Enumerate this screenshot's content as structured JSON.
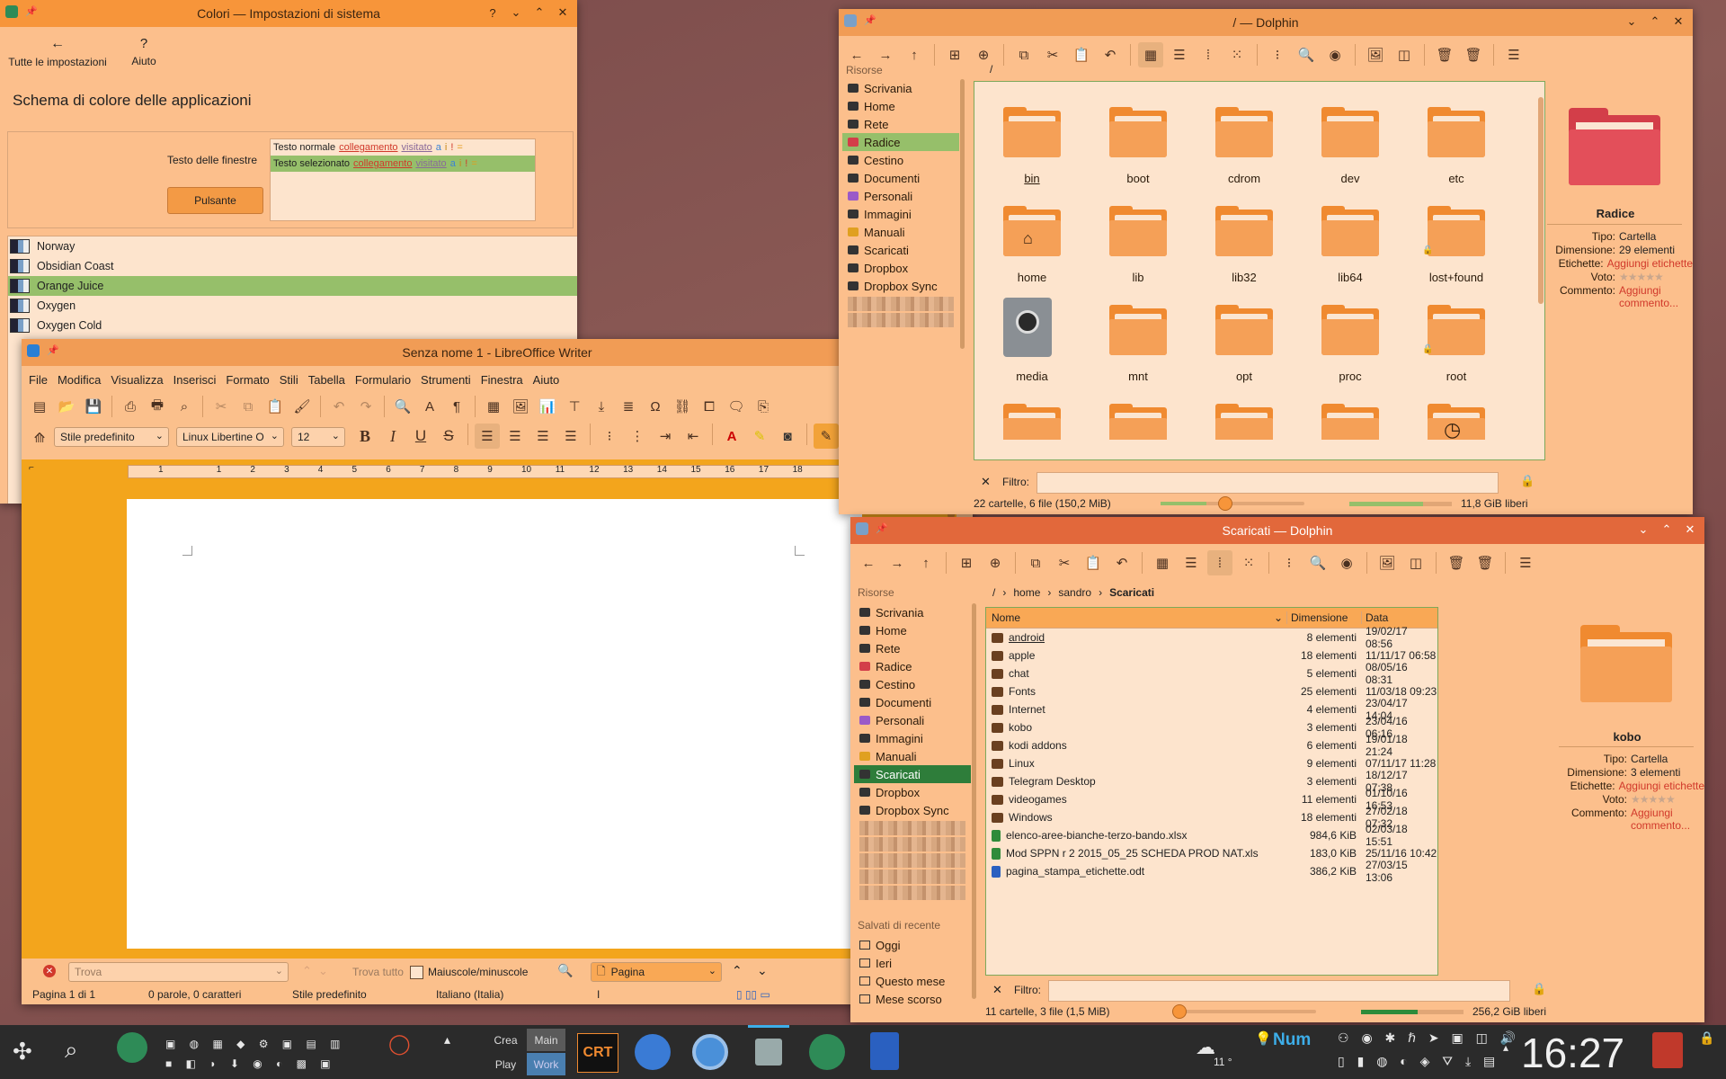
{
  "colors_window": {
    "title": "Colori — Impostazioni di sistema",
    "nav_all": "Tutte le impostazioni",
    "nav_help": "Aiuto",
    "heading": "Schema di colore delle applicazioni",
    "preview_window_text_label": "Testo delle finestre",
    "preview_button_label": "Pulsante",
    "preview_normal": "Testo normale",
    "preview_selected": "Testo selezionato",
    "preview_link": "collegamento",
    "preview_visited": "visitato",
    "preview_glyphs": [
      "a",
      "i",
      "!",
      "="
    ],
    "schemes": [
      {
        "name": "Norway"
      },
      {
        "name": "Obsidian Coast"
      },
      {
        "name": "Orange Juice"
      },
      {
        "name": "Oxygen"
      },
      {
        "name": "Oxygen Cold"
      }
    ],
    "selected_scheme": "Orange Juice"
  },
  "writer_window": {
    "title": "Senza nome 1 - LibreOffice Writer",
    "menu": [
      "File",
      "Modifica",
      "Visualizza",
      "Inserisci",
      "Formato",
      "Stili",
      "Tabella",
      "Formulario",
      "Strumenti",
      "Finestra",
      "Aiuto"
    ],
    "style_value": "Stile predefinito",
    "font_value": "Linux Libertine O",
    "size_value": "12",
    "ruler_numbers": [
      "1",
      "1",
      "2",
      "3",
      "4",
      "5",
      "6",
      "7",
      "8",
      "9",
      "10",
      "11",
      "12",
      "13",
      "14",
      "15",
      "16",
      "17",
      "18"
    ],
    "find_placeholder": "Trova",
    "find_all": "Trova tutto",
    "match_case": "Maiuscole/minuscole",
    "search_scope": "Pagina",
    "status_page": "Pagina 1 di 1",
    "status_words": "0 parole, 0 caratteri",
    "status_style": "Stile predefinito",
    "status_lang": "Italiano (Italia)"
  },
  "dolphin_root": {
    "title": "/ — Dolphin",
    "places_title": "Risorse",
    "places": [
      "Scrivania",
      "Home",
      "Rete",
      "Radice",
      "Cestino",
      "Documenti",
      "Personali",
      "Immagini",
      "Manuali",
      "Scaricati",
      "Dropbox",
      "Dropbox Sync"
    ],
    "selected_place": "Radice",
    "breadcrumb": "/",
    "folders": [
      "bin",
      "boot",
      "cdrom",
      "dev",
      "etc",
      "home",
      "lib",
      "lib32",
      "lib64",
      "lost+found",
      "media",
      "mnt",
      "opt",
      "proc",
      "root"
    ],
    "filter_label": "Filtro:",
    "status": "22 cartelle, 6 file (150,2 MiB)",
    "free": "11,8 GiB liberi",
    "info": {
      "name": "Radice",
      "type_k": "Tipo:",
      "type_v": "Cartella",
      "size_k": "Dimensione:",
      "size_v": "29 elementi",
      "tags_k": "Etichette:",
      "tags_v": "Aggiungi etichette",
      "rating_k": "Voto:",
      "comment_k": "Commento:",
      "comment_v": "Aggiungi commento..."
    }
  },
  "dolphin_dl": {
    "title": "Scaricati — Dolphin",
    "places_title": "Risorse",
    "places": [
      "Scrivania",
      "Home",
      "Rete",
      "Radice",
      "Cestino",
      "Documenti",
      "Personali",
      "Immagini",
      "Manuali",
      "Scaricati",
      "Dropbox",
      "Dropbox Sync"
    ],
    "selected_place": "Scaricati",
    "recent_title": "Salvati di recente",
    "recent": [
      "Oggi",
      "Ieri",
      "Questo mese",
      "Mese scorso"
    ],
    "breadcrumb": [
      "/",
      "home",
      "sandro",
      "Scaricati"
    ],
    "columns": [
      "Nome",
      "Dimensione",
      "Data"
    ],
    "files": [
      {
        "name": "android",
        "size": "8 elementi",
        "date": "19/02/17 08:56"
      },
      {
        "name": "apple",
        "size": "18 elementi",
        "date": "11/11/17 06:58"
      },
      {
        "name": "chat",
        "size": "5 elementi",
        "date": "08/05/16 08:31"
      },
      {
        "name": "Fonts",
        "size": "25 elementi",
        "date": "11/03/18 09:23"
      },
      {
        "name": "Internet",
        "size": "4 elementi",
        "date": "23/04/17 14:04"
      },
      {
        "name": "kobo",
        "size": "3 elementi",
        "date": "23/04/16 06:16"
      },
      {
        "name": "kodi addons",
        "size": "6 elementi",
        "date": "19/01/18 21:24"
      },
      {
        "name": "Linux",
        "size": "9 elementi",
        "date": "07/11/17 11:28"
      },
      {
        "name": "Telegram Desktop",
        "size": "3 elementi",
        "date": "18/12/17 07:38"
      },
      {
        "name": "videogames",
        "size": "11 elementi",
        "date": "01/10/16 16:53"
      },
      {
        "name": "Windows",
        "size": "18 elementi",
        "date": "27/02/18 07:32"
      },
      {
        "name": "elenco-aree-bianche-terzo-bando.xlsx",
        "size": "984,6 KiB",
        "date": "02/03/18 15:51"
      },
      {
        "name": "Mod SPPN r 2 2015_05_25 SCHEDA PROD NAT.xls",
        "size": "183,0 KiB",
        "date": "25/11/16 10:42"
      },
      {
        "name": "pagina_stampa_etichette.odt",
        "size": "386,2 KiB",
        "date": "27/03/15 13:06"
      }
    ],
    "filter_label": "Filtro:",
    "status": "11 cartelle, 3 file (1,5 MiB)",
    "free": "256,2 GiB liberi",
    "info": {
      "name": "kobo",
      "type_k": "Tipo:",
      "type_v": "Cartella",
      "size_k": "Dimensione:",
      "size_v": "3 elementi",
      "tags_k": "Etichette:",
      "tags_v": "Aggiungi etichette",
      "rating_k": "Voto:",
      "comment_k": "Commento:",
      "comment_v": "Aggiungi commento..."
    }
  },
  "taskbar": {
    "crea": "Crea",
    "main": "Main",
    "play": "Play",
    "work": "Work",
    "crt": "CRT",
    "num": "Num",
    "weather": "11 °",
    "clock": "16:27"
  }
}
